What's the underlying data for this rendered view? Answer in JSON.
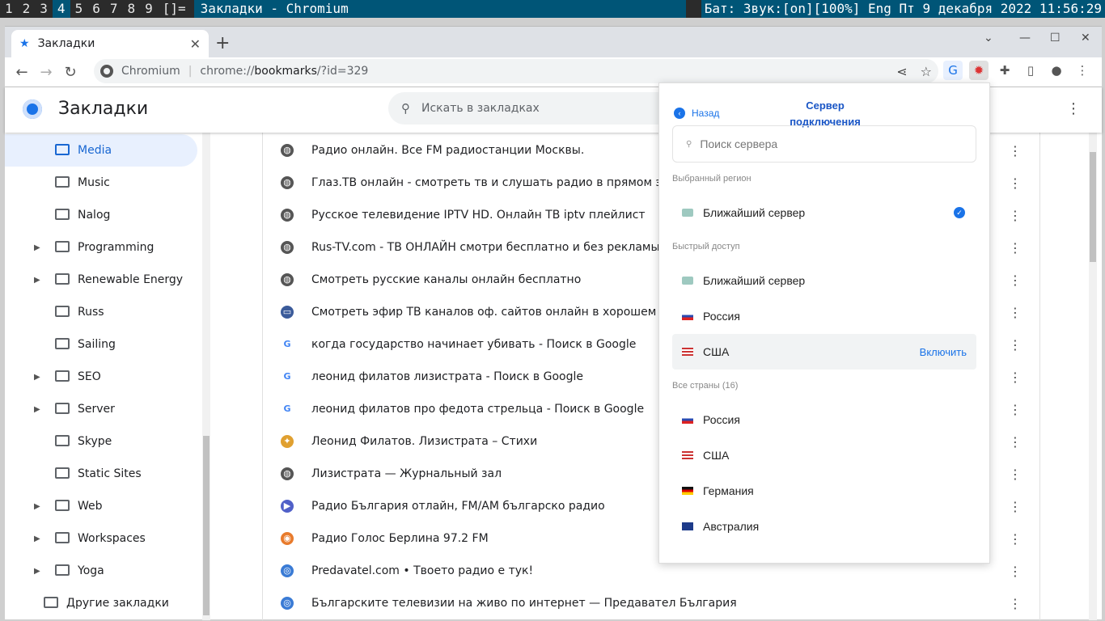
{
  "wm": {
    "workspaces": [
      "1",
      "2",
      "3",
      "4",
      "5",
      "6",
      "7",
      "8",
      "9",
      "[]="
    ],
    "active_index": 3,
    "title": "Закладки - Chromium",
    "status": "Бат: Звук:[on][100%] Eng Пт  9 декабря 2022 11:56:29"
  },
  "tab": {
    "title": "Закладки",
    "close": "✕"
  },
  "window_buttons": {
    "dropdown": "⌄",
    "minimize": "—",
    "maximize": "☐",
    "close": "✕"
  },
  "omnibox": {
    "site": "Chromium",
    "url_prefix": "chrome://",
    "url_host": "bookmarks",
    "url_rest": "/?id=329"
  },
  "page": {
    "title": "Закладки",
    "search_placeholder": "Искать в закладках"
  },
  "sidebar": {
    "items": [
      {
        "label": "Media",
        "selected": true,
        "expandable": false
      },
      {
        "label": "Music",
        "expandable": false
      },
      {
        "label": "Nalog",
        "expandable": false
      },
      {
        "label": "Programming",
        "expandable": true
      },
      {
        "label": "Renewable Energy",
        "expandable": true
      },
      {
        "label": "Russ",
        "expandable": false
      },
      {
        "label": "Sailing",
        "expandable": false
      },
      {
        "label": "SEO",
        "expandable": true
      },
      {
        "label": "Server",
        "expandable": true
      },
      {
        "label": "Skype",
        "expandable": false
      },
      {
        "label": "Static Sites",
        "expandable": false
      },
      {
        "label": "Web",
        "expandable": true
      },
      {
        "label": "Workspaces",
        "expandable": true
      },
      {
        "label": "Yoga",
        "expandable": true
      }
    ],
    "other": "Другие закладки"
  },
  "bookmarks": [
    {
      "title": "Радио онлайн. Все FM радиостанции Москвы.",
      "icon": "globe-icon"
    },
    {
      "title": "Глаз.ТВ онлайн - смотреть тв и слушать радио в прямом эфире бе",
      "icon": "globe-icon"
    },
    {
      "title": "Русское телевидение IPTV HD. Онлайн ТВ iptv плейлист",
      "icon": "globe-icon"
    },
    {
      "title": "Rus-TV.com - ТВ ОНЛАЙН смотри бесплатно и без рекламы",
      "icon": "globe-icon"
    },
    {
      "title": "Смотреть русские каналы онлайн бесплатно",
      "icon": "globe-icon"
    },
    {
      "title": "Смотреть эфир ТВ каналов оф. сайтов онлайн в хорошем качестве",
      "icon": "monitor-icon"
    },
    {
      "title": "когда государство начинает убивать - Поиск в Google",
      "icon": "google-icon"
    },
    {
      "title": "леонид филатов лизистрата - Поиск в Google",
      "icon": "google-icon"
    },
    {
      "title": "леонид филатов про федота стрельца - Поиск в Google",
      "icon": "google-icon"
    },
    {
      "title": "Леонид Филатов. Лизистрата – Стихи",
      "icon": "bird-icon"
    },
    {
      "title": "Лизистрата — Журнальный зал",
      "icon": "globe-icon"
    },
    {
      "title": "Радио България отлайн, FM/AM българско радио",
      "icon": "play-icon"
    },
    {
      "title": "Радио Голос Берлина 97.2 FM",
      "icon": "radio-icon"
    },
    {
      "title": "Predavatel.com • Твоето радио е тук!",
      "icon": "signal-icon"
    },
    {
      "title": "Българските телевизии на живо по интернет — Предавател България",
      "icon": "signal-icon"
    }
  ],
  "popup": {
    "back": "Назад",
    "title": "Сервер подключения",
    "search_placeholder": "Поиск сервера",
    "sec_selected": "Выбранный регион",
    "selected": {
      "name": "Ближайший сервер",
      "flag": "near"
    },
    "sec_quick": "Быстрый доступ",
    "quick": [
      {
        "name": "Ближайший сервер",
        "flag": "near"
      },
      {
        "name": "Россия",
        "flag": "ru"
      },
      {
        "name": "США",
        "flag": "us",
        "action": "Включить"
      }
    ],
    "sec_all": "Все страны (16)",
    "all": [
      {
        "name": "Россия",
        "flag": "ru"
      },
      {
        "name": "США",
        "flag": "us"
      },
      {
        "name": "Германия",
        "flag": "de"
      },
      {
        "name": "Австралия",
        "flag": "au"
      }
    ]
  },
  "colors": {
    "accent": "#1a73e8",
    "wm_active": "#005577"
  }
}
